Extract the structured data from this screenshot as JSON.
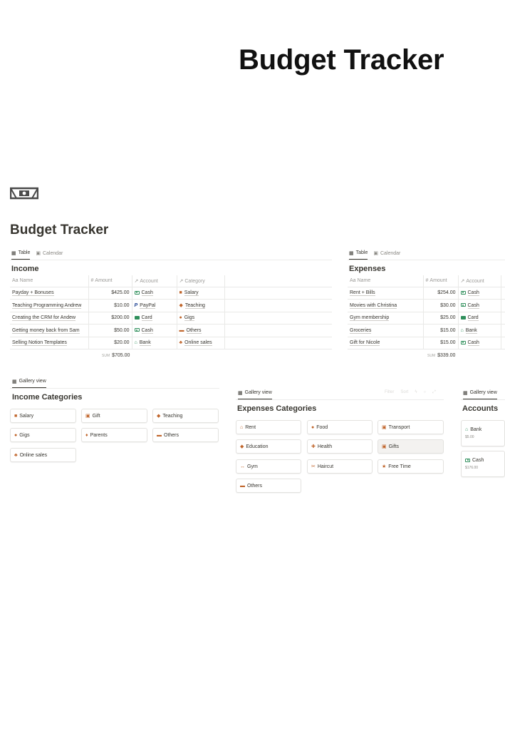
{
  "hero_title": "Budget Tracker",
  "page": {
    "icon": "money-bill-icon",
    "title": "Budget Tracker"
  },
  "income": {
    "tabs": [
      {
        "label": "Table",
        "icon": "table-icon"
      },
      {
        "label": "Calendar",
        "icon": "calendar-icon"
      }
    ],
    "title": "Income",
    "columns": [
      {
        "label": "Name",
        "icon": "text-icon"
      },
      {
        "label": "Amount",
        "icon": "hash-icon"
      },
      {
        "label": "Account",
        "icon": "relation-arrow-icon"
      },
      {
        "label": "Category",
        "icon": "relation-arrow-icon"
      }
    ],
    "rows": [
      {
        "name": "Payday + Bonuses",
        "amount": "$425.00",
        "account": "Cash",
        "account_icon": "cash-icon",
        "category": "Salary",
        "category_icon": "briefcase-icon"
      },
      {
        "name": "Teaching Programming Andrew",
        "amount": "$10.00",
        "account": "PayPal",
        "account_icon": "paypal-icon",
        "category": "Teaching",
        "category_icon": "graduation-cap-icon"
      },
      {
        "name": "Creating the CRM for Andew",
        "amount": "$200.00",
        "account": "Card",
        "account_icon": "card-icon",
        "category": "Gigs",
        "category_icon": "gig-icon"
      },
      {
        "name": "Getting money back from Sam",
        "amount": "$50.00",
        "account": "Cash",
        "account_icon": "cash-icon",
        "category": "Others",
        "category_icon": "box-icon"
      },
      {
        "name": "Selling Notion Templates",
        "amount": "$20.00",
        "account": "Bank",
        "account_icon": "bank-icon",
        "category": "Online sales",
        "category_icon": "sitemap-icon"
      }
    ],
    "sum_label": "SUM",
    "sum_value": "$705.00"
  },
  "expenses": {
    "tabs": [
      {
        "label": "Table",
        "icon": "table-icon"
      },
      {
        "label": "Calendar",
        "icon": "calendar-icon"
      }
    ],
    "title": "Expenses",
    "columns": [
      {
        "label": "Name",
        "icon": "text-icon"
      },
      {
        "label": "Amount",
        "icon": "hash-icon"
      },
      {
        "label": "Account",
        "icon": "relation-arrow-icon"
      }
    ],
    "rows": [
      {
        "name": "Rent + Bills",
        "amount": "$254.00",
        "account": "Cash",
        "account_icon": "cash-icon"
      },
      {
        "name": "Movies with Christina",
        "amount": "$30.00",
        "account": "Cash",
        "account_icon": "cash-icon"
      },
      {
        "name": "Gym membership",
        "amount": "$25.00",
        "account": "Card",
        "account_icon": "card-icon"
      },
      {
        "name": "Groceries",
        "amount": "$15.00",
        "account": "Bank",
        "account_icon": "bank-icon"
      },
      {
        "name": "Gift for Nicole",
        "amount": "$15.00",
        "account": "Cash",
        "account_icon": "cash-icon"
      }
    ],
    "sum_label": "SUM",
    "sum_value": "$339.00"
  },
  "income_categories": {
    "tab": "Gallery view",
    "title": "Income Categories",
    "cards": [
      {
        "label": "Salary",
        "icon": "briefcase-icon"
      },
      {
        "label": "Gift",
        "icon": "gift-icon"
      },
      {
        "label": "Teaching",
        "icon": "graduation-cap-icon"
      },
      {
        "label": "Gigs",
        "icon": "gig-icon"
      },
      {
        "label": "Parents",
        "icon": "parents-icon"
      },
      {
        "label": "Others",
        "icon": "box-icon"
      },
      {
        "label": "Online sales",
        "icon": "sitemap-icon"
      }
    ]
  },
  "expenses_categories": {
    "tab": "Gallery view",
    "title": "Expenses Categories",
    "toolbar": {
      "filter": "Filter",
      "sort": "Sort"
    },
    "cards": [
      {
        "label": "Rent",
        "icon": "home-icon"
      },
      {
        "label": "Food",
        "icon": "food-icon"
      },
      {
        "label": "Transport",
        "icon": "bus-icon"
      },
      {
        "label": "Education",
        "icon": "graduation-cap-icon"
      },
      {
        "label": "Health",
        "icon": "medkit-icon"
      },
      {
        "label": "Gifts",
        "icon": "gift-icon"
      },
      {
        "label": "Gym",
        "icon": "dumbbell-icon"
      },
      {
        "label": "Haircut",
        "icon": "haircut-icon"
      },
      {
        "label": "Free Time",
        "icon": "party-icon"
      },
      {
        "label": "Others",
        "icon": "box-icon"
      }
    ]
  },
  "accounts": {
    "tab": "Gallery view",
    "title": "Accounts",
    "cards": [
      {
        "label": "Bank",
        "icon": "bank-icon",
        "value": "$5.00"
      },
      {
        "label": "Cash",
        "icon": "cash-icon",
        "value": "$176.00"
      }
    ]
  }
}
